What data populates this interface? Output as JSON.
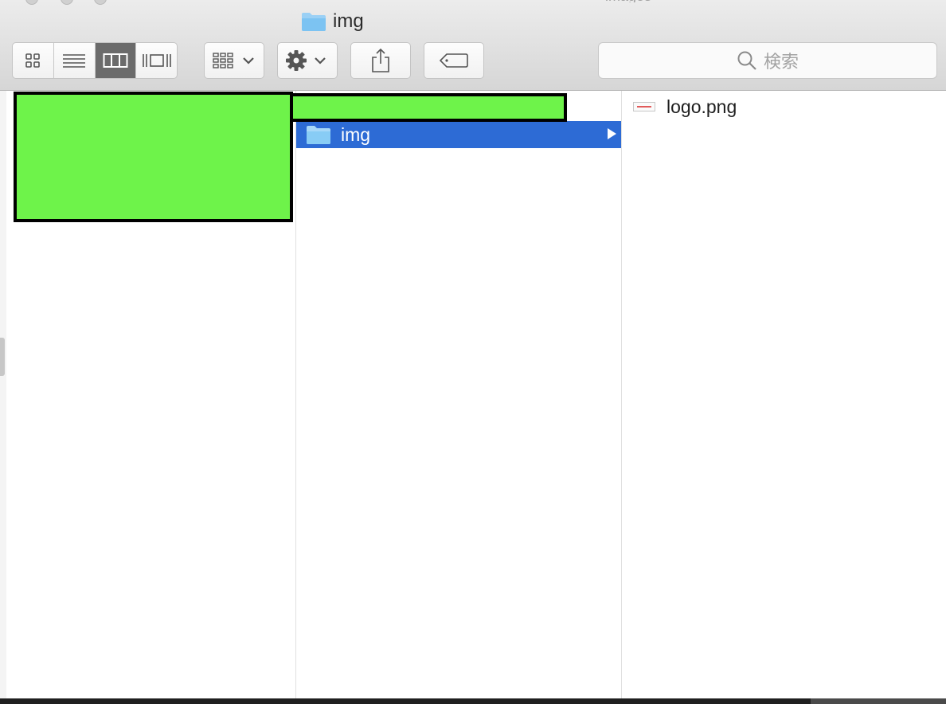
{
  "window": {
    "title": "img",
    "background_tab_title": "images"
  },
  "toolbar": {
    "view_modes": [
      "icon",
      "list",
      "column",
      "gallery"
    ],
    "active_view": "column",
    "arrange_icon": "grid-arrange-icon",
    "action_icon": "gear-icon",
    "share_icon": "share-icon",
    "tag_icon": "tag-icon"
  },
  "search": {
    "placeholder": "検索"
  },
  "columns": {
    "col2": {
      "selected_item": "img"
    },
    "col3": {
      "files": [
        {
          "name": "logo.png",
          "icon": "png-file-icon"
        }
      ]
    }
  },
  "colors": {
    "selection": "#2d6bd5",
    "redaction": "#6ef34a",
    "folder": "#7cc3f2"
  }
}
